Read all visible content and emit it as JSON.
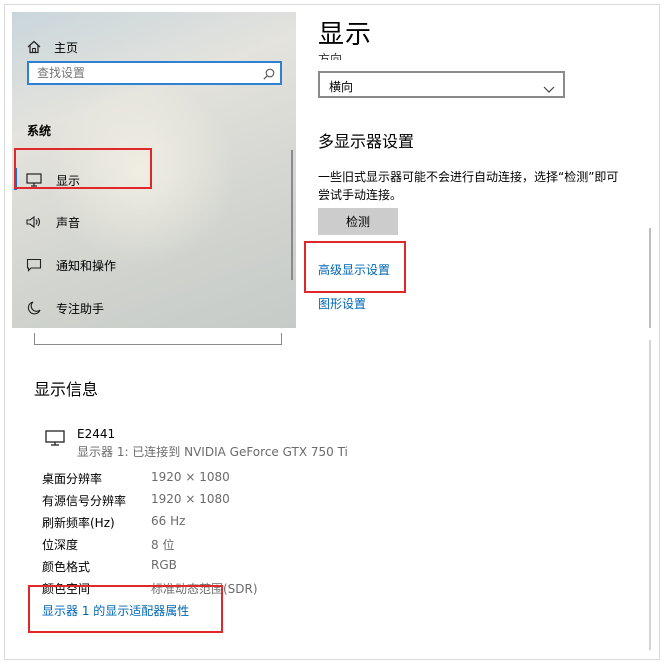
{
  "sidebar": {
    "home_label": "主页",
    "search_placeholder": "查找设置",
    "section_title": "系统",
    "items": [
      {
        "label": "显示",
        "icon": "monitor-icon"
      },
      {
        "label": "声音",
        "icon": "speaker-icon"
      },
      {
        "label": "通知和操作",
        "icon": "message-icon"
      },
      {
        "label": "专注助手",
        "icon": "moon-icon"
      }
    ]
  },
  "main": {
    "title": "显示",
    "orientation_label_partial": "方向",
    "orientation_value": "横向",
    "multi_display_title": "多显示器设置",
    "multi_display_desc": "一些旧式显示器可能不会进行自动连接，选择“检测”即可尝试手动连接。",
    "detect_button": "检测",
    "advanced_link": "高级显示设置",
    "graphics_link": "图形设置"
  },
  "display_info": {
    "title": "显示信息",
    "monitor_name": "E2441",
    "monitor_sub": "显示器 1: 已连接到 NVIDIA GeForce GTX 750 Ti",
    "properties": [
      {
        "key": "桌面分辨率",
        "value": "1920 × 1080"
      },
      {
        "key": "有源信号分辨率",
        "value": "1920 × 1080"
      },
      {
        "key": "刷新频率(Hz)",
        "value": "66 Hz"
      },
      {
        "key": "位深度",
        "value": "8 位"
      },
      {
        "key": "颜色格式",
        "value": "RGB"
      },
      {
        "key": "颜色空间",
        "value": "标准动态范围(SDR)"
      }
    ],
    "adapter_link": "显示器 1 的显示适配器属性"
  },
  "colors": {
    "accent": "#0066b4",
    "highlight_box": "#e0272a",
    "search_border": "#2f7fd3"
  }
}
